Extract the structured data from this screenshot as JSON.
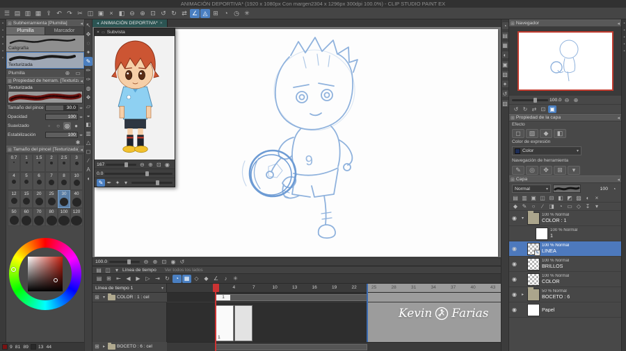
{
  "colors": {
    "accent": "#4a7fc1",
    "selection": "#4d79bd",
    "playhead": "#cc3333",
    "clip_end": "#3a6ab0",
    "sketch": "#8fb2dd",
    "canvas_border": "#c23b2e"
  },
  "ui": {
    "menu": "⊞",
    "collapse": "◂",
    "close": "×",
    "dropdown": "▾",
    "expand": "▸",
    "eye": "◉",
    "plus": "⊕",
    "minus": "⊖",
    "trash": "▭",
    "wrench": "✱",
    "pen": "✎",
    "gauge": "◔"
  },
  "title_bar": {
    "title": "ANIMACIÓN DEPORTIVA* (1920 x 1080px Con margen2304 x 1296px 300dpi 100.0%)  - CLIP STUDIO PAINT EX"
  },
  "command_bar": {
    "icons": [
      {
        "n": "menu",
        "g": "☰"
      },
      {
        "n": "new-canvas",
        "g": "▤"
      },
      {
        "n": "open-file",
        "g": "▥"
      },
      {
        "n": "save",
        "g": "▦"
      },
      {
        "n": "export",
        "g": "⇪"
      },
      {
        "n": "undo",
        "g": "↶"
      },
      {
        "n": "redo",
        "g": "↷"
      },
      {
        "n": "cut",
        "g": "✂"
      },
      {
        "n": "copy",
        "g": "◫"
      },
      {
        "n": "paste",
        "g": "▣"
      },
      {
        "n": "delete",
        "g": "×"
      },
      {
        "n": "fill",
        "g": "◧"
      },
      {
        "n": "zoom-out",
        "g": "⊖"
      },
      {
        "n": "zoom-in",
        "g": "⊕"
      },
      {
        "n": "fit-screen",
        "g": "⊡"
      },
      {
        "n": "rotate-ccw",
        "g": "↺"
      },
      {
        "n": "rotate-cw",
        "g": "↻"
      },
      {
        "n": "flip-horizontal",
        "g": "⇄"
      },
      {
        "n": "snap-ruler",
        "g": "∠",
        "a": 1
      },
      {
        "n": "snap-special-ruler",
        "g": "◬",
        "a": 1
      },
      {
        "n": "grid",
        "g": "⊞"
      },
      {
        "n": "onion-skin",
        "g": "◔"
      },
      {
        "n": "timeline-toggle",
        "g": "◷"
      },
      {
        "n": "settings",
        "g": "✳"
      }
    ]
  },
  "tool_bar": {
    "icons": [
      {
        "n": "operation-tool",
        "g": "↖"
      },
      {
        "n": "move-tool",
        "g": "✥"
      },
      {
        "n": "selection-tool",
        "g": "◌"
      },
      {
        "n": "auto-select-tool",
        "g": "✦"
      },
      {
        "n": "pen-tool",
        "g": "✎",
        "sel": 1
      },
      {
        "n": "pencil-tool",
        "g": "✏"
      },
      {
        "n": "brush-tool",
        "g": "✑"
      },
      {
        "n": "airbrush-tool",
        "g": "◍"
      },
      {
        "n": "decoration-tool",
        "g": "❖"
      },
      {
        "n": "eraser-tool",
        "g": "▱"
      },
      {
        "n": "blend-tool",
        "g": "◒"
      },
      {
        "n": "fill-tool",
        "g": "◧"
      },
      {
        "n": "gradient-tool",
        "g": "▥"
      },
      {
        "n": "figure-tool",
        "g": "△"
      },
      {
        "n": "frame-border-tool",
        "g": "◻"
      },
      {
        "n": "ruler-tool",
        "g": "∕"
      },
      {
        "n": "text-tool",
        "g": "A"
      },
      {
        "n": "balloon-tool",
        "g": "◖"
      }
    ]
  },
  "left_strip": {
    "icons": [
      {
        "n": "strip-1",
        "g": "▪"
      },
      {
        "n": "strip-2",
        "g": "▪"
      },
      {
        "n": "strip-3",
        "g": "▪"
      },
      {
        "n": "strip-4",
        "g": "▪"
      },
      {
        "n": "strip-5",
        "g": "▪"
      },
      {
        "n": "strip-6",
        "g": "▪"
      }
    ]
  },
  "right_edge": {
    "icons": [
      {
        "n": "edge-1",
        "g": "▪"
      },
      {
        "n": "edge-2",
        "g": "▪"
      },
      {
        "n": "edge-3",
        "g": "▪"
      },
      {
        "n": "edge-4",
        "g": "▪"
      },
      {
        "n": "edge-5",
        "g": "▪"
      }
    ]
  },
  "left_panels": {
    "subtool": {
      "title": "Subherramienta [Plumilla]",
      "footer_label": "Plumilla",
      "tabs": [
        {
          "label": "Plumilla",
          "active": true
        },
        {
          "label": "Marcador",
          "active": false
        }
      ],
      "items": [
        {
          "name": "Caligrafía",
          "selected": false
        },
        {
          "name": "Texturizada",
          "selected": true
        }
      ]
    },
    "tool_property": {
      "title": "Propiedad de herram. [Texturiza",
      "preview_label": "Texturizada",
      "smoothing_options": [
        {
          "n": "smoothing-none",
          "g": "◦"
        },
        {
          "n": "smoothing-weak",
          "g": "○"
        },
        {
          "n": "smoothing-mid",
          "g": "◎",
          "a": 1
        },
        {
          "n": "smoothing-strong",
          "g": "●"
        }
      ],
      "params": [
        {
          "label": "Tamaño del pincel",
          "value": "30.0",
          "type": "slider",
          "fill": 55
        },
        {
          "label": "Opacidad",
          "value": "100",
          "type": "slider",
          "fill": 100
        },
        {
          "label": "Suavizado",
          "value": "",
          "type": "circles"
        },
        {
          "label": "Estabilización",
          "value": "100",
          "type": "slider",
          "fill": 100
        }
      ]
    },
    "brush_size": {
      "title": "Tamaño del pincel [Texturizada]",
      "selected": "30",
      "sizes": [
        "0.7",
        "1",
        "1.5",
        "2",
        "2.5",
        "3",
        "4",
        "5",
        "6",
        "7",
        "8",
        "10",
        "12",
        "15",
        "20",
        "25",
        "30",
        "40",
        "50",
        "60",
        "70",
        "80",
        "100",
        "120"
      ]
    },
    "color_wheel": {
      "values_left": [
        "9",
        "81",
        "89"
      ],
      "values_right": [
        "13",
        "44"
      ]
    }
  },
  "canvas": {
    "tab": "ANIMACIÓN DEPORTIVA*",
    "zoom": "100.0",
    "jersey_number": "9"
  },
  "subview": {
    "title": "Subvista",
    "zoom": "167",
    "angle": "0.0"
  },
  "subview_controls": {
    "zoom_icons": [
      {
        "n": "sv-zoom-out",
        "g": "⊖"
      },
      {
        "n": "sv-zoom-in",
        "g": "⊕"
      },
      {
        "n": "sv-fit",
        "g": "⊡"
      },
      {
        "n": "sv-actual",
        "g": "◉"
      }
    ],
    "tool_icons": [
      {
        "n": "sv-pen",
        "g": "✎",
        "a": 1
      },
      {
        "n": "sv-eyedropper",
        "g": "✒"
      },
      {
        "n": "sv-pin",
        "g": "✦"
      },
      {
        "n": "sv-menu",
        "g": "▾"
      }
    ]
  },
  "status_bar": {
    "icons": [
      {
        "n": "status-zoom-out",
        "g": "⊖"
      },
      {
        "n": "status-zoom-in",
        "g": "⊕"
      },
      {
        "n": "status-fit",
        "g": "⊡"
      },
      {
        "n": "status-actual-size",
        "g": "◉"
      },
      {
        "n": "status-rotate-reset",
        "g": "↺"
      }
    ]
  },
  "timeline": {
    "title": "Línea de tiempo",
    "note": "Ver todos los lados",
    "name": "Línea de tiempo 1",
    "header_icons": [
      {
        "n": "tl-menu",
        "g": "▤"
      },
      {
        "n": "tl-list",
        "g": "◫"
      },
      {
        "n": "tl-options",
        "g": "▾"
      }
    ],
    "frames": [
      1,
      4,
      7,
      10,
      13,
      16,
      19,
      22
    ],
    "frames_after": [
      25,
      28,
      31,
      34,
      37,
      40,
      43
    ],
    "current_frame": 1,
    "tracks": [
      {
        "label": "COLOR : 1 : cel"
      },
      {
        "label": "BOCETO : 6 : cel"
      }
    ],
    "cel_number": "1",
    "watermark": {
      "first": "Kevin",
      "last": "Farias"
    }
  },
  "transport": {
    "icons": [
      {
        "n": "cel-menu",
        "g": "▤"
      },
      {
        "n": "new-cel",
        "g": "⊞"
      },
      {
        "n": "skip-to-start",
        "g": "⇤"
      },
      {
        "n": "prev-frame",
        "g": "◀"
      },
      {
        "n": "play",
        "g": "▶"
      },
      {
        "n": "next-frame",
        "g": "▷"
      },
      {
        "n": "skip-to-end",
        "g": "⇥"
      },
      {
        "n": "loop-playback",
        "g": "↻"
      },
      {
        "n": "onion-skin-toggle",
        "g": "◔",
        "a": 1
      },
      {
        "n": "light-table",
        "g": "▦",
        "a": 1
      },
      {
        "n": "enable-keyframes",
        "g": "◇"
      },
      {
        "n": "add-keyframe",
        "g": "◆"
      },
      {
        "n": "snap-toggle",
        "g": "∠"
      },
      {
        "n": "sound",
        "g": "♪"
      },
      {
        "n": "timeline-settings",
        "g": "✳"
      }
    ]
  },
  "right_dock": {
    "icons": [
      {
        "n": "color-wheel-tab",
        "g": "◔"
      },
      {
        "n": "color-slider-tab",
        "g": "▤"
      },
      {
        "n": "color-set-tab",
        "g": "▦"
      },
      {
        "n": "color-mix-tab",
        "g": "◐"
      },
      {
        "n": "subview-tab",
        "g": "▣"
      },
      {
        "n": "item-bank-tab",
        "g": "▧"
      },
      {
        "n": "illustration-tab",
        "g": "✦"
      },
      {
        "n": "history-tab",
        "g": "↺"
      },
      {
        "n": "material-tab",
        "g": "▨"
      }
    ]
  },
  "navigator": {
    "title": "Navegador",
    "zoom": "100.0",
    "zoom_icons": [
      {
        "n": "nav-zoom-out",
        "g": "⊖"
      },
      {
        "n": "nav-zoom-in",
        "g": "⊕"
      }
    ],
    "rotate_icons": [
      {
        "n": "nav-rotate-ccw",
        "g": "↺"
      },
      {
        "n": "nav-rotate-cw",
        "g": "↻"
      },
      {
        "n": "nav-flip",
        "g": "⇄"
      },
      {
        "n": "nav-reset",
        "g": "⊡"
      },
      {
        "n": "nav-fit",
        "g": "▣",
        "a": 1
      }
    ]
  },
  "layer_property": {
    "title": "Propiedad de la capa",
    "effect_label": "Efecto",
    "effect_icons": [
      {
        "n": "border-effect",
        "g": "◻"
      },
      {
        "n": "tone-effect",
        "g": "▨"
      },
      {
        "n": "layer-color-effect",
        "g": "◆"
      },
      {
        "n": "extract-line-effect",
        "g": "◧"
      }
    ],
    "expression_label": "Color de expresión",
    "expression_value": "Color",
    "tool_nav_label": "Navegación de herramienta",
    "tool_nav_icons": [
      {
        "n": "toolnav-pen",
        "g": "✎"
      },
      {
        "n": "toolnav-zoom",
        "g": "◎"
      },
      {
        "n": "toolnav-move",
        "g": "✥"
      },
      {
        "n": "toolnav-grid",
        "g": "⊞"
      },
      {
        "n": "toolnav-more",
        "g": "▾"
      }
    ]
  },
  "layers": {
    "title": "Capa",
    "blend_mode": "Normal",
    "opacity": "100",
    "cmd_icons_1": [
      {
        "n": "new-raster-layer",
        "g": "▤"
      },
      {
        "n": "new-vector-layer",
        "g": "▥"
      },
      {
        "n": "new-folder",
        "g": "▣"
      },
      {
        "n": "duplicate-layer",
        "g": "◫"
      },
      {
        "n": "merge-down",
        "g": "⊟"
      },
      {
        "n": "clip-at-layer",
        "g": "◧"
      },
      {
        "n": "lock-layer",
        "g": "◩"
      },
      {
        "n": "lock-transparent",
        "g": "▨"
      },
      {
        "n": "enable-mask",
        "g": "◐"
      },
      {
        "n": "delete-layer",
        "g": "×"
      }
    ],
    "cmd_icons_2": [
      {
        "n": "set-as-reference",
        "g": "◆"
      },
      {
        "n": "draft-layer",
        "g": "✎"
      },
      {
        "n": "layer-mask",
        "g": "○"
      },
      {
        "n": "layer-ruler",
        "g": "∕"
      },
      {
        "n": "two-pane-view",
        "g": "◨"
      },
      {
        "n": "layer-onion",
        "g": "◔"
      },
      {
        "n": "palette-option-1",
        "g": "▭"
      },
      {
        "n": "palette-option-2",
        "g": "◇"
      },
      {
        "n": "palette-option-3",
        "g": "↧"
      },
      {
        "n": "palette-menu",
        "g": "▾"
      }
    ],
    "items": [
      {
        "percent": "100 % Normal",
        "name": "COLOR : 1",
        "thumb": "folder",
        "arrow": "▾",
        "eye": true
      },
      {
        "percent": "100 % Normal",
        "name": "1",
        "thumb": "white",
        "indent": true,
        "eye": false
      },
      {
        "percent": "100 % Normal",
        "name": "LINEA",
        "thumb": "checker",
        "selected": true,
        "badge": true,
        "eye": true
      },
      {
        "percent": "100 % Normal",
        "name": "BRILLOS",
        "thumb": "checker",
        "eye": true
      },
      {
        "percent": "100 % Normal",
        "name": "COLOR",
        "thumb": "checker",
        "eye": true
      },
      {
        "percent": "50 % Normal",
        "name": "BOCETO : 6",
        "thumb": "folder",
        "arrow": "▸",
        "eye": true
      },
      {
        "percent": "",
        "name": "Papel",
        "thumb": "white",
        "eye": true
      }
    ]
  }
}
